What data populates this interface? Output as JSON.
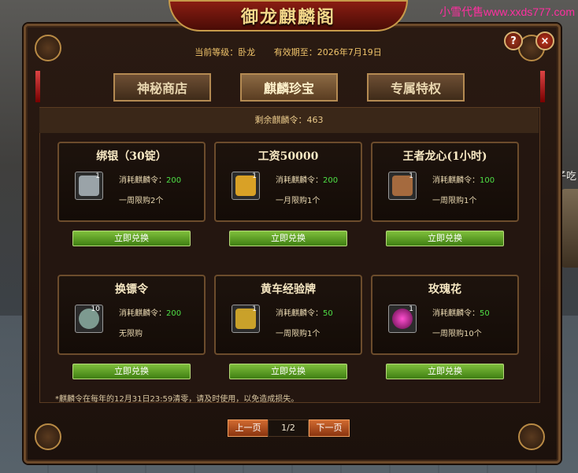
{
  "watermark": "小雪代售www.xxds777.com",
  "side_text": "子吃",
  "window": {
    "title": "御龙麒麟阁",
    "help_label": "?",
    "close_label": "×"
  },
  "info": {
    "level_label": "当前等级：卧龙",
    "expiry_label": "有效期至：2026年7月19日"
  },
  "tabs": [
    {
      "label": "神秘商店",
      "active": false
    },
    {
      "label": "麒麟珍宝",
      "active": true
    },
    {
      "label": "专属特权",
      "active": false
    }
  ],
  "remaining_label": "剩余麒麟令：463",
  "items": [
    {
      "name": "绑银（30锭）",
      "qty": "1",
      "cost_label": "消耗麒麟令：",
      "cost": "200",
      "limit": "一周限购2个",
      "icon": "silver-ingot-icon",
      "color": "#9aa3a8"
    },
    {
      "name": "工资50000",
      "qty": "1",
      "cost_label": "消耗麒麟令：",
      "cost": "200",
      "limit": "一月限购1个",
      "icon": "gold-ingot-icon",
      "color": "#d9a126"
    },
    {
      "name": "王者龙心(1小时)",
      "qty": "1",
      "cost_label": "消耗麒麟令：",
      "cost": "100",
      "limit": "一周限购1个",
      "icon": "dragon-heart-icon",
      "color": "#a56a3e"
    },
    {
      "name": "换镖令",
      "qty": "10",
      "cost_label": "消耗麒麟令：",
      "cost": "200",
      "limit": "无限购",
      "icon": "escort-token-icon",
      "color": "#7d9a90"
    },
    {
      "name": "黄车经验牌",
      "qty": "1",
      "cost_label": "消耗麒麟令：",
      "cost": "50",
      "limit": "一周限购1个",
      "icon": "exp-card-icon",
      "color": "#c9a12a"
    },
    {
      "name": "玫瑰花",
      "qty": "1",
      "cost_label": "消耗麒麟令：",
      "cost": "50",
      "limit": "一周限购10个",
      "icon": "rose-icon",
      "color": "#c02b9a"
    }
  ],
  "redeem_label": "立即兑换",
  "notice": "*麒麟令在每年的12月31日23:59清零，请及时使用，以免造成损失。",
  "pager": {
    "prev": "上一页",
    "page": "1/2",
    "next": "下一页"
  }
}
